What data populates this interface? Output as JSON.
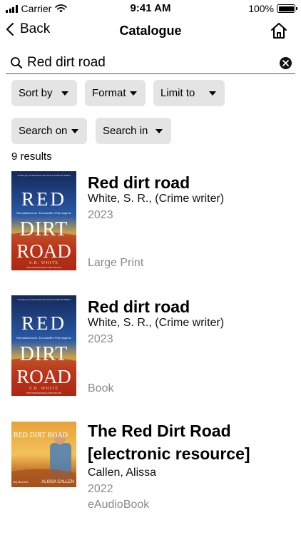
{
  "status_bar": {
    "carrier": "Carrier",
    "time": "9:41 AM",
    "battery": "100%"
  },
  "nav": {
    "back_label": "Back",
    "title": "Catalogue"
  },
  "search": {
    "value": "Red dirt road"
  },
  "filters": {
    "sort_by": "Sort by",
    "format": "Format",
    "limit_to": "Limit to",
    "search_on": "Search on",
    "search_in": "Search in"
  },
  "results_count": "9 results",
  "results": [
    {
      "title": "Red dirt road",
      "author": "White, S. R., (Crime writer)",
      "year": "2023",
      "format": "Large Print",
      "cover": {
        "tagline": "'A rising star of Australian crime fiction' SUNDAY TIMES",
        "blurb": "One outback town. Two murders. Fifty suspects.",
        "line1": "RED",
        "line2": "DIRT",
        "line3": "ROAD",
        "author": "S.R. WHITE",
        "footer": "THE INTERNATIONAL BESTSELLER"
      }
    },
    {
      "title": "Red dirt road",
      "author": "White, S. R., (Crime writer)",
      "year": "2023",
      "format": "Book",
      "cover": {
        "tagline": "'A rising star of Australian crime fiction' SUNDAY TIMES",
        "blurb": "One outback town. Two murders. Fifty suspects.",
        "line1": "RED",
        "line2": "DIRT",
        "line3": "ROAD",
        "author": "S.R. WHITE",
        "footer": "THE INTERNATIONAL BESTSELLER"
      }
    },
    {
      "title_line1": "The Red Dirt Road",
      "title_line2": "[electronic resource]",
      "author": "Callen, Alissa",
      "year": "2022",
      "format": "eAudioBook",
      "cover": {
        "title": "THE RED DIRT ROAD",
        "author": "ALISSA CALLEN",
        "publisher": "HQ BOOKS"
      }
    }
  ]
}
